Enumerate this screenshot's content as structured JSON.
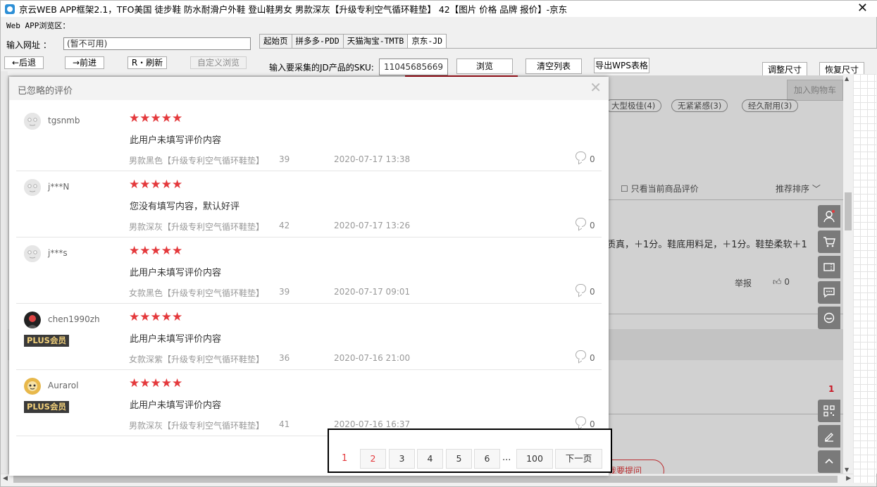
{
  "window": {
    "title": "京云WEB APP框架2.1，TFO美国 徒步鞋 防水耐滑户外鞋 登山鞋男女 男款深灰【升级专利空气循环鞋垫】 42【图片 价格 品牌 报价】-京东",
    "close_icon": "close-icon"
  },
  "browser": {
    "area_label": "Web APP浏览区：",
    "url_label": "输入网址 ：",
    "url_value": "(暂不可用)",
    "back_label": "←后退",
    "forward_label": "→前进",
    "refresh_label": "R・刷新",
    "custom_browse_label": "自定义浏览"
  },
  "tabs": [
    "起始页",
    "拼多多-PDD",
    "天猫淘宝-TMTB",
    "京东-JD"
  ],
  "tabs_active_index": 3,
  "toolbar": {
    "sku_label": "输入要采集的JD产品的SKU:",
    "sku_value": "11045685669",
    "browse_label": "浏览",
    "clear_label": "清空列表",
    "export_label": "导出WPS表格",
    "resize_label": "调整尺寸",
    "restore_label": "恢复尺寸"
  },
  "background_page": {
    "cart_button": "加入购物车",
    "tags": [
      "大型极佳(4)",
      "无紧紧感(3)",
      "经久耐用(3)"
    ],
    "only_current": "只看当前商品评价",
    "sort_label": "推荐排序",
    "review_snippet": "质真，＋1分。鞋底用料足，＋1分。鞋垫柔软＋1",
    "report_label": "举报",
    "like_count": "0",
    "ask_button": "我要提问",
    "rail_badge": "1"
  },
  "dialog": {
    "title": "已忽略的评价",
    "reviews": [
      {
        "user": "tgsnmb",
        "plus": "",
        "stars": "★★★★★",
        "content": "此用户未填写评价内容",
        "product": "男款黑色【升级专利空气循环鞋垫】",
        "size": "39",
        "date": "2020-07-17 13:38",
        "replies": "0"
      },
      {
        "user": "j***N",
        "plus": "",
        "stars": "★★★★★",
        "content": "您没有填写内容，默认好评",
        "product": "男款深灰【升级专利空气循环鞋垫】",
        "size": "42",
        "date": "2020-07-17 13:26",
        "replies": "0"
      },
      {
        "user": "j***s",
        "plus": "",
        "stars": "★★★★★",
        "content": "此用户未填写评价内容",
        "product": "女款黑色【升级专利空气循环鞋垫】",
        "size": "39",
        "date": "2020-07-17 09:01",
        "replies": "0"
      },
      {
        "user": "chen1990zh",
        "plus": "PLUS会员",
        "stars": "★★★★★",
        "content": "此用户未填写评价内容",
        "product": "女款深紫【升级专利空气循环鞋垫】",
        "size": "36",
        "date": "2020-07-16 21:00",
        "replies": "0"
      },
      {
        "user": "Aurarol",
        "plus": "PLUS会员",
        "stars": "★★★★★",
        "content": "此用户未填写评价内容",
        "product": "男款深灰【升级专利空气循环鞋垫】",
        "size": "41",
        "date": "2020-07-16 16:37",
        "replies": "0"
      }
    ]
  },
  "pagination": {
    "current": "1",
    "pages": [
      "2",
      "3",
      "4",
      "5",
      "6"
    ],
    "ellipsis": "...",
    "last": "100",
    "next": "下一页"
  },
  "colors": {
    "accent_red": "#e4393c",
    "jd_red": "#c81623",
    "plus_gold": "#f0cf7a"
  }
}
